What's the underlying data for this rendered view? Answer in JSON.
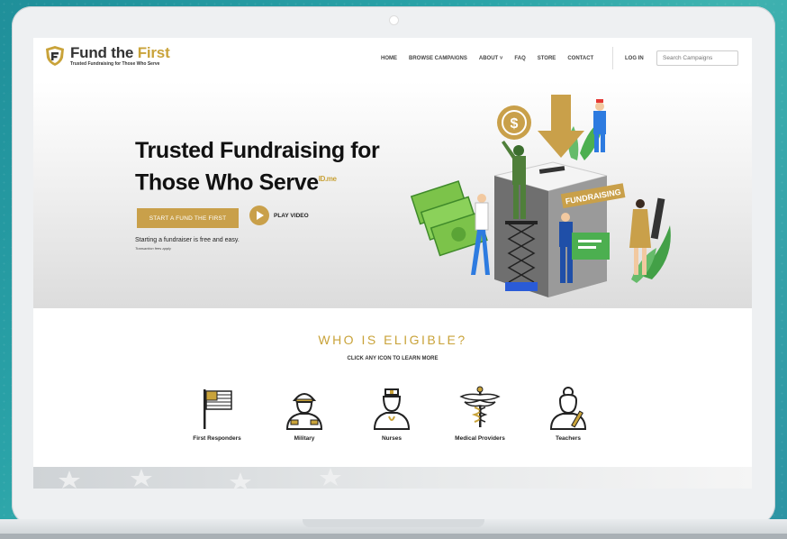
{
  "brand": {
    "name_part1": "Fund the ",
    "name_part2": "First",
    "tagline": "Trusted Fundraising for Those Who Serve"
  },
  "nav": {
    "items": [
      "HOME",
      "BROWSE CAMPAIGNS",
      "ABOUT ˅",
      "FAQ",
      "STORE",
      "CONTACT"
    ],
    "login": "LOG IN",
    "search_placeholder": "Search Campaigns"
  },
  "hero": {
    "title_line1": "Trusted Fundraising for",
    "title_line2": "Those Who Serve",
    "badge": "ID.me",
    "cta": "START A FUND THE FIRST",
    "play": "PLAY VIDEO",
    "subtext": "Starting a fundraiser is free and easy.",
    "fineprint": "Transaction fees apply",
    "box_label": "FUNDRAISING"
  },
  "eligibility": {
    "title": "WHO IS ELIGIBLE?",
    "subtitle": "CLICK ANY ICON TO LEARN MORE",
    "categories": [
      {
        "label": "First Responders",
        "icon": "flag-icon"
      },
      {
        "label": "Military",
        "icon": "soldier-icon"
      },
      {
        "label": "Nurses",
        "icon": "nurse-icon"
      },
      {
        "label": "Medical Providers",
        "icon": "caduceus-icon"
      },
      {
        "label": "Teachers",
        "icon": "teacher-icon"
      }
    ]
  },
  "colors": {
    "gold": "#c9a33a",
    "teal_bg": "#2aa3a8"
  }
}
